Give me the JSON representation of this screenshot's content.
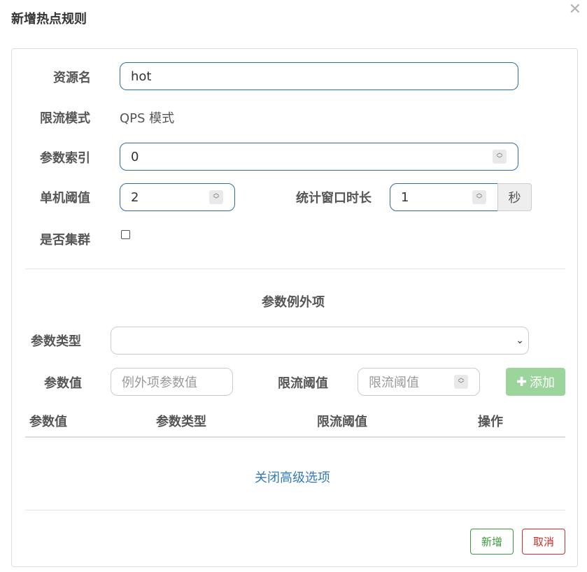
{
  "dialog": {
    "title": "新增热点规则",
    "close_icon": "close-icon"
  },
  "form": {
    "resource_label": "资源名",
    "resource_value": "hot",
    "mode_label": "限流模式",
    "mode_value": "QPS 模式",
    "param_index_label": "参数索引",
    "param_index_value": "0",
    "threshold_label": "单机阈值",
    "threshold_value": "2",
    "window_label": "统计窗口时长",
    "window_value": "1",
    "window_unit": "秒",
    "cluster_label": "是否集群",
    "cluster_checked": false
  },
  "exceptions": {
    "section_title": "参数例外项",
    "type_label": "参数类型",
    "type_value": "",
    "value_label": "参数值",
    "value_placeholder": "例外项参数值",
    "limit_label": "限流阈值",
    "limit_placeholder": "限流阈值",
    "add_label": "添加",
    "table_headers": [
      "参数值",
      "参数类型",
      "限流阈值",
      "操作"
    ]
  },
  "footer": {
    "toggle_advanced": "关闭高级选项",
    "submit_label": "新增",
    "cancel_label": "取消"
  },
  "colors": {
    "primary_border": "#2e6da4",
    "add_button_bg": "#9cd59c",
    "submit_color": "#3c9a3c",
    "cancel_color": "#c9302c",
    "link_color": "#337ab7"
  }
}
